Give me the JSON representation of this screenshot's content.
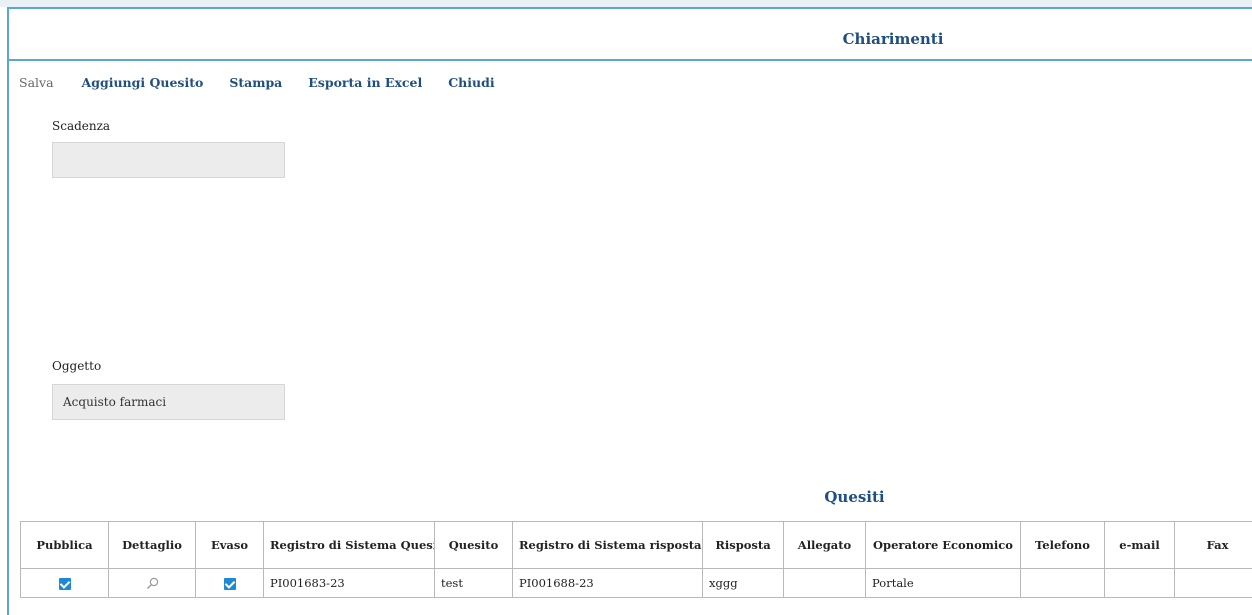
{
  "header": {
    "title": "Chiarimenti"
  },
  "toolbar": {
    "save": "Salva",
    "add_question": "Aggiungi Quesito",
    "print": "Stampa",
    "export_excel": "Esporta in Excel",
    "close": "Chiudi"
  },
  "fields": {
    "scadenza": {
      "label": "Scadenza",
      "value": ""
    },
    "oggetto": {
      "label": "Oggetto",
      "value": "Acquisto farmaci"
    }
  },
  "quesiti": {
    "title": "Quesiti",
    "columns": [
      "Pubblica",
      "Dettaglio",
      "Evaso",
      "Registro di Sistema Quesito",
      "Quesito",
      "Registro di Sistema risposta",
      "Risposta",
      "Allegato",
      "Operatore Economico",
      "Telefono",
      "e-mail",
      "Fax"
    ],
    "rows": [
      {
        "pubblica": true,
        "dettaglio_icon": "magnifier-icon",
        "evaso": true,
        "registro_quesito": "PI001683-23",
        "quesito": "test",
        "registro_risposta": "PI001688-23",
        "risposta": "xggg",
        "allegato": "",
        "operatore": "Portale",
        "telefono": "",
        "email": "",
        "fax": ""
      }
    ]
  },
  "colors": {
    "accent": "#1f4f80",
    "border": "#5aa6d6",
    "checkbox": "#1e88d8"
  }
}
